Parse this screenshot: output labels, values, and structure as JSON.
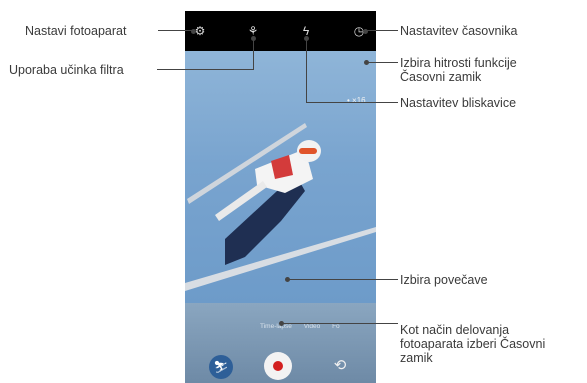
{
  "labels": {
    "camera_settings": "Nastavi fotoaparat",
    "filter_effect": "Uporaba učinka filtra",
    "timer_setting": "Nastavitev časovnika",
    "time_lock_speed_line1": "Izbira hitrosti funkcije",
    "time_lock_speed_line2": "Časovni zamik",
    "flash_setting": "Nastavitev bliskavice",
    "zoom_select": "Izbira povečave",
    "mode_select_line1": "Kot način delovanja",
    "mode_select_line2": "fotoaparata izberi Časovni",
    "mode_select_line3": "zamik"
  },
  "camera": {
    "speed_indicator": "• ×16",
    "zoom_button": "1",
    "modes": [
      "Time-lapse",
      "Video",
      "Fo"
    ],
    "icons": [
      "gear-icon",
      "filter-icon",
      "flash-off-icon",
      "timer-icon",
      "gallery-thumbnail-icon",
      "switch-camera-icon"
    ]
  }
}
